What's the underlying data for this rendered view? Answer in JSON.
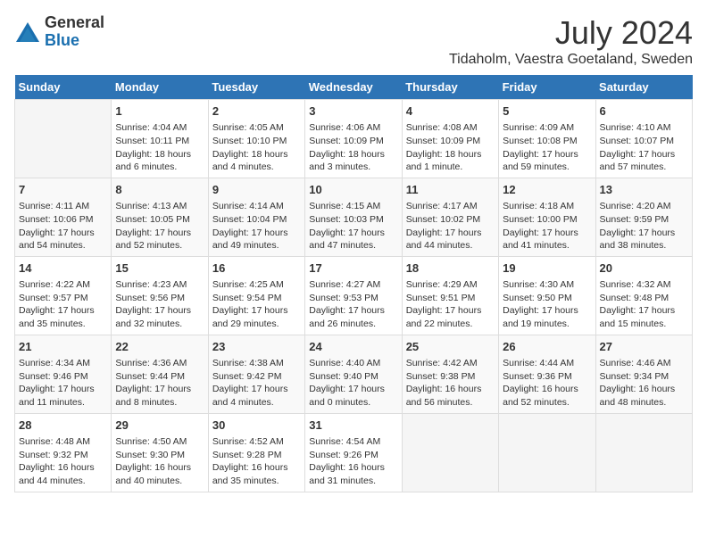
{
  "logo": {
    "general": "General",
    "blue": "Blue"
  },
  "header": {
    "month": "July 2024",
    "location": "Tidaholm, Vaestra Goetaland, Sweden"
  },
  "days_of_week": [
    "Sunday",
    "Monday",
    "Tuesday",
    "Wednesday",
    "Thursday",
    "Friday",
    "Saturday"
  ],
  "weeks": [
    [
      {
        "day": "",
        "info": ""
      },
      {
        "day": "1",
        "info": "Sunrise: 4:04 AM\nSunset: 10:11 PM\nDaylight: 18 hours\nand 6 minutes."
      },
      {
        "day": "2",
        "info": "Sunrise: 4:05 AM\nSunset: 10:10 PM\nDaylight: 18 hours\nand 4 minutes."
      },
      {
        "day": "3",
        "info": "Sunrise: 4:06 AM\nSunset: 10:09 PM\nDaylight: 18 hours\nand 3 minutes."
      },
      {
        "day": "4",
        "info": "Sunrise: 4:08 AM\nSunset: 10:09 PM\nDaylight: 18 hours\nand 1 minute."
      },
      {
        "day": "5",
        "info": "Sunrise: 4:09 AM\nSunset: 10:08 PM\nDaylight: 17 hours\nand 59 minutes."
      },
      {
        "day": "6",
        "info": "Sunrise: 4:10 AM\nSunset: 10:07 PM\nDaylight: 17 hours\nand 57 minutes."
      }
    ],
    [
      {
        "day": "7",
        "info": "Sunrise: 4:11 AM\nSunset: 10:06 PM\nDaylight: 17 hours\nand 54 minutes."
      },
      {
        "day": "8",
        "info": "Sunrise: 4:13 AM\nSunset: 10:05 PM\nDaylight: 17 hours\nand 52 minutes."
      },
      {
        "day": "9",
        "info": "Sunrise: 4:14 AM\nSunset: 10:04 PM\nDaylight: 17 hours\nand 49 minutes."
      },
      {
        "day": "10",
        "info": "Sunrise: 4:15 AM\nSunset: 10:03 PM\nDaylight: 17 hours\nand 47 minutes."
      },
      {
        "day": "11",
        "info": "Sunrise: 4:17 AM\nSunset: 10:02 PM\nDaylight: 17 hours\nand 44 minutes."
      },
      {
        "day": "12",
        "info": "Sunrise: 4:18 AM\nSunset: 10:00 PM\nDaylight: 17 hours\nand 41 minutes."
      },
      {
        "day": "13",
        "info": "Sunrise: 4:20 AM\nSunset: 9:59 PM\nDaylight: 17 hours\nand 38 minutes."
      }
    ],
    [
      {
        "day": "14",
        "info": "Sunrise: 4:22 AM\nSunset: 9:57 PM\nDaylight: 17 hours\nand 35 minutes."
      },
      {
        "day": "15",
        "info": "Sunrise: 4:23 AM\nSunset: 9:56 PM\nDaylight: 17 hours\nand 32 minutes."
      },
      {
        "day": "16",
        "info": "Sunrise: 4:25 AM\nSunset: 9:54 PM\nDaylight: 17 hours\nand 29 minutes."
      },
      {
        "day": "17",
        "info": "Sunrise: 4:27 AM\nSunset: 9:53 PM\nDaylight: 17 hours\nand 26 minutes."
      },
      {
        "day": "18",
        "info": "Sunrise: 4:29 AM\nSunset: 9:51 PM\nDaylight: 17 hours\nand 22 minutes."
      },
      {
        "day": "19",
        "info": "Sunrise: 4:30 AM\nSunset: 9:50 PM\nDaylight: 17 hours\nand 19 minutes."
      },
      {
        "day": "20",
        "info": "Sunrise: 4:32 AM\nSunset: 9:48 PM\nDaylight: 17 hours\nand 15 minutes."
      }
    ],
    [
      {
        "day": "21",
        "info": "Sunrise: 4:34 AM\nSunset: 9:46 PM\nDaylight: 17 hours\nand 11 minutes."
      },
      {
        "day": "22",
        "info": "Sunrise: 4:36 AM\nSunset: 9:44 PM\nDaylight: 17 hours\nand 8 minutes."
      },
      {
        "day": "23",
        "info": "Sunrise: 4:38 AM\nSunset: 9:42 PM\nDaylight: 17 hours\nand 4 minutes."
      },
      {
        "day": "24",
        "info": "Sunrise: 4:40 AM\nSunset: 9:40 PM\nDaylight: 17 hours\nand 0 minutes."
      },
      {
        "day": "25",
        "info": "Sunrise: 4:42 AM\nSunset: 9:38 PM\nDaylight: 16 hours\nand 56 minutes."
      },
      {
        "day": "26",
        "info": "Sunrise: 4:44 AM\nSunset: 9:36 PM\nDaylight: 16 hours\nand 52 minutes."
      },
      {
        "day": "27",
        "info": "Sunrise: 4:46 AM\nSunset: 9:34 PM\nDaylight: 16 hours\nand 48 minutes."
      }
    ],
    [
      {
        "day": "28",
        "info": "Sunrise: 4:48 AM\nSunset: 9:32 PM\nDaylight: 16 hours\nand 44 minutes."
      },
      {
        "day": "29",
        "info": "Sunrise: 4:50 AM\nSunset: 9:30 PM\nDaylight: 16 hours\nand 40 minutes."
      },
      {
        "day": "30",
        "info": "Sunrise: 4:52 AM\nSunset: 9:28 PM\nDaylight: 16 hours\nand 35 minutes."
      },
      {
        "day": "31",
        "info": "Sunrise: 4:54 AM\nSunset: 9:26 PM\nDaylight: 16 hours\nand 31 minutes."
      },
      {
        "day": "",
        "info": ""
      },
      {
        "day": "",
        "info": ""
      },
      {
        "day": "",
        "info": ""
      }
    ]
  ]
}
